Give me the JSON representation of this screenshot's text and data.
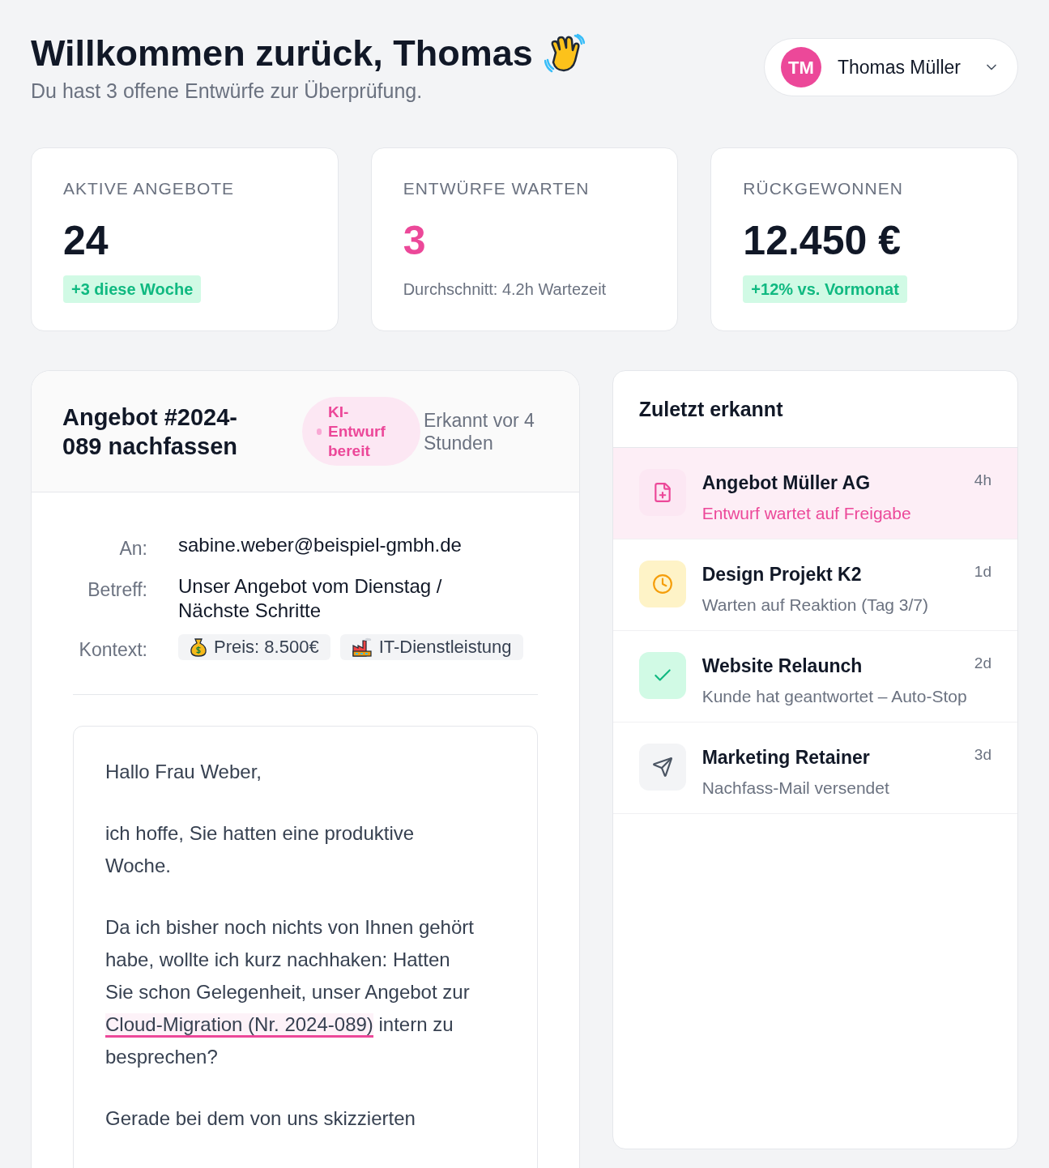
{
  "header": {
    "title": "Willkommen zurück, Thomas",
    "subtitle": "Du hast 3 offene Entwürfe zur Überprüfung."
  },
  "user": {
    "initials": "TM",
    "name": "Thomas Müller"
  },
  "stats": [
    {
      "label": "AKTIVE ANGEBOTE",
      "value": "24",
      "kind": "badge",
      "note": "+3 diese Woche",
      "highlight": false
    },
    {
      "label": "ENTWÜRFE WARTEN",
      "value": "3",
      "kind": "text",
      "note": "Durchschnitt: 4.2h Wartezeit",
      "highlight": true
    },
    {
      "label": "RÜCKGEWONNEN",
      "value": "12.450 €",
      "kind": "badge",
      "note": "+12% vs. Vormonat",
      "highlight": false
    }
  ],
  "draft": {
    "title": "Angebot #2024-089 nachfassen",
    "badge": "KI-Entwurf bereit",
    "detected": "Erkannt vor 4 Stunden",
    "fields": [
      {
        "label": "An:",
        "kind": "text",
        "value": "sabine.weber@beispiel-gmbh.de"
      },
      {
        "label": "Betreff:",
        "kind": "text",
        "value": "Unser Angebot vom Dienstag / Nächste Schritte"
      },
      {
        "label": "Kontext:",
        "kind": "tags",
        "tags": [
          {
            "kind": "price",
            "text": "Preis: 8.500€"
          },
          {
            "kind": "industry",
            "text": "IT-Dienstleistung"
          }
        ]
      }
    ],
    "body": [
      {
        "parts": [
          {
            "text": "Hallo Frau Weber,",
            "kind": "plain"
          }
        ]
      },
      {
        "parts": [
          {
            "text": "ich hoffe, Sie hatten eine produktive Woche.",
            "kind": "plain"
          }
        ]
      },
      {
        "parts": [
          {
            "text": "Da ich bisher noch nichts von Ihnen gehört habe, wollte ich kurz nachhaken: Hatten Sie schon Gelegenheit, unser Angebot zur ",
            "kind": "plain"
          },
          {
            "text": "Cloud-Migration (Nr. 2024-089)",
            "kind": "highlight"
          },
          {
            "text": " intern zu besprechen?",
            "kind": "plain"
          }
        ]
      },
      {
        "parts": [
          {
            "text": "Gerade bei dem von uns skizzierten",
            "kind": "plain"
          }
        ]
      }
    ]
  },
  "recent": {
    "title": "Zuletzt erkannt",
    "items": [
      {
        "title": "Angebot Müller AG",
        "subtitle": "Entwurf wartet auf Freigabe",
        "time": "4h",
        "kind": "draft",
        "selected": true
      },
      {
        "title": "Design Projekt K2",
        "subtitle": "Warten auf Reaktion (Tag 3/7)",
        "time": "1d",
        "kind": "waiting",
        "selected": false
      },
      {
        "title": "Website Relaunch",
        "subtitle": "Kunde hat geantwortet – Auto-Stop",
        "time": "2d",
        "kind": "done",
        "selected": false
      },
      {
        "title": "Marketing Retainer",
        "subtitle": "Nachfass-Mail versendet",
        "time": "3d",
        "kind": "sent",
        "selected": false
      }
    ]
  }
}
